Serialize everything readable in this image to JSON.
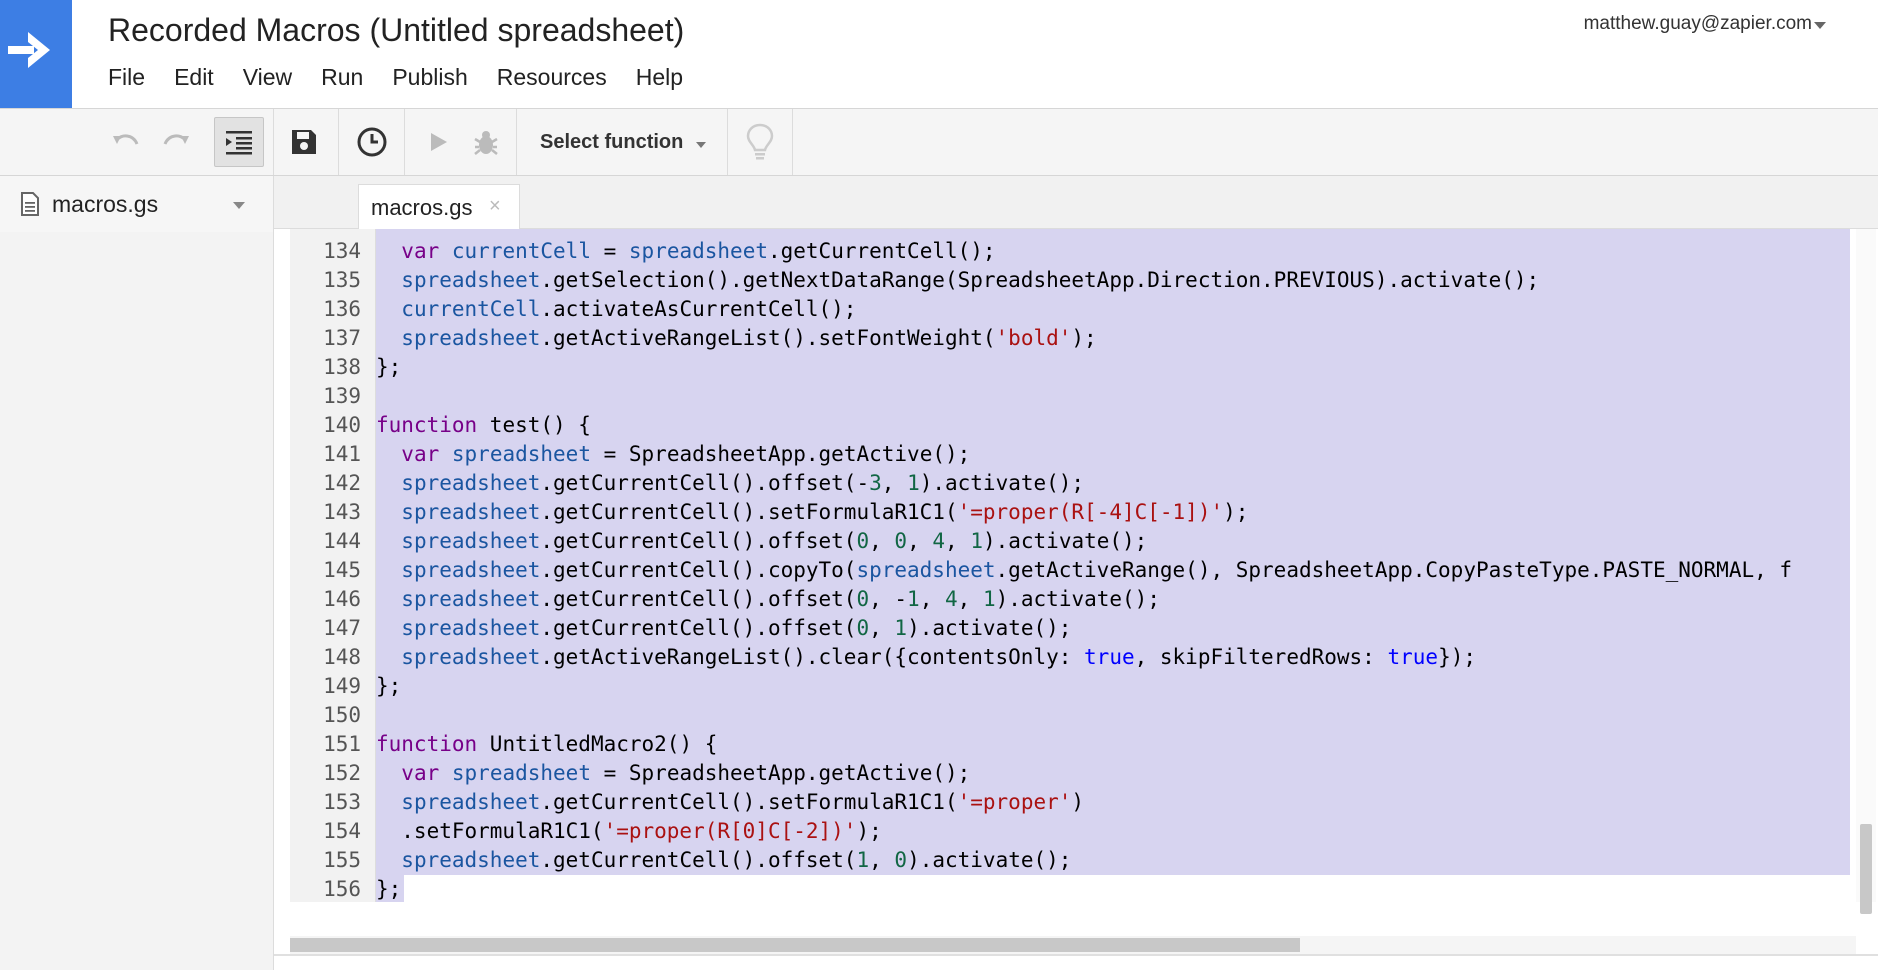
{
  "app": {
    "title": "Recorded Macros (Untitled spreadsheet)",
    "account": "matthew.guay@zapier.com",
    "brand_color": "#3d7ee4"
  },
  "menu": [
    "File",
    "Edit",
    "View",
    "Run",
    "Publish",
    "Resources",
    "Help"
  ],
  "toolbar": {
    "select_function": "Select function",
    "icons": [
      "undo-icon",
      "redo-icon",
      "indent-icon",
      "save-icon",
      "clock-trigger-icon",
      "run-icon",
      "debug-icon",
      "lightbulb-icon"
    ]
  },
  "sidebar": {
    "file": "macros.gs"
  },
  "editor": {
    "tab": "macros.gs",
    "close_glyph": "×",
    "selection_color": "#d7d4f0",
    "lines": [
      {
        "n": "134",
        "t": "  var currentCell = spreadsheet.getCurrentCell();"
      },
      {
        "n": "135",
        "t": "  spreadsheet.getSelection().getNextDataRange(SpreadsheetApp.Direction.PREVIOUS).activate();"
      },
      {
        "n": "136",
        "t": "  currentCell.activateAsCurrentCell();"
      },
      {
        "n": "137",
        "t": "  spreadsheet.getActiveRangeList().setFontWeight('bold');"
      },
      {
        "n": "138",
        "t": "};"
      },
      {
        "n": "139",
        "t": ""
      },
      {
        "n": "140",
        "t": "function test() {"
      },
      {
        "n": "141",
        "t": "  var spreadsheet = SpreadsheetApp.getActive();"
      },
      {
        "n": "142",
        "t": "  spreadsheet.getCurrentCell().offset(-3, 1).activate();"
      },
      {
        "n": "143",
        "t": "  spreadsheet.getCurrentCell().setFormulaR1C1('=proper(R[-4]C[-1])');"
      },
      {
        "n": "144",
        "t": "  spreadsheet.getCurrentCell().offset(0, 0, 4, 1).activate();"
      },
      {
        "n": "145",
        "t": "  spreadsheet.getCurrentCell().copyTo(spreadsheet.getActiveRange(), SpreadsheetApp.CopyPasteType.PASTE_NORMAL, f"
      },
      {
        "n": "146",
        "t": "  spreadsheet.getCurrentCell().offset(0, -1, 4, 1).activate();"
      },
      {
        "n": "147",
        "t": "  spreadsheet.getCurrentCell().offset(0, 1).activate();"
      },
      {
        "n": "148",
        "t": "  spreadsheet.getActiveRangeList().clear({contentsOnly: true, skipFilteredRows: true});"
      },
      {
        "n": "149",
        "t": "};"
      },
      {
        "n": "150",
        "t": ""
      },
      {
        "n": "151",
        "t": "function UntitledMacro2() {"
      },
      {
        "n": "152",
        "t": "  var spreadsheet = SpreadsheetApp.getActive();"
      },
      {
        "n": "153",
        "t": "  spreadsheet.getCurrentCell().setFormulaR1C1('=proper')"
      },
      {
        "n": "154",
        "t": "  .setFormulaR1C1('=proper(R[0]C[-2])');"
      },
      {
        "n": "155",
        "t": "  spreadsheet.getCurrentCell().offset(1, 0).activate();"
      },
      {
        "n": "156",
        "t": "};"
      }
    ]
  }
}
